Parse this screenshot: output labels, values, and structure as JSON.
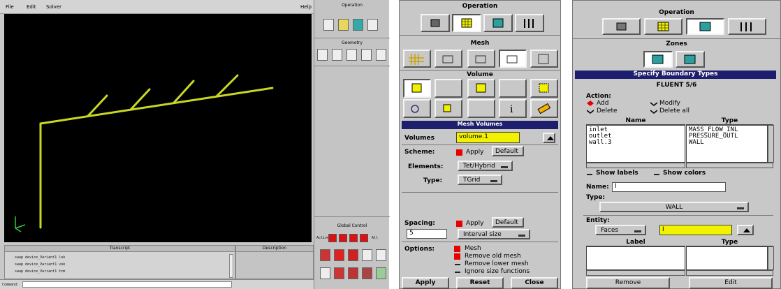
{
  "gambit": {
    "menu": [
      "File",
      "Edit",
      "Solver",
      "Help"
    ],
    "operation_title": "Operation",
    "geometry_title": "Geometry",
    "global_control_title": "Global Control",
    "global_control_label": "Active",
    "global_control_all": "All",
    "transcript_title": "Transcript",
    "description_title": "Description",
    "transcript_lines": [
      "swap device_Variant1 lok",
      "swap device_Variant1 vok",
      "swap device_Variant1 tcm"
    ],
    "command_label": "Command:",
    "colors": {
      "viewport": "#000000",
      "model": "#c9d820",
      "axis": "#38c838"
    }
  },
  "mesh_panel": {
    "operation_title": "Operation",
    "mesh_title": "Mesh",
    "volume_title": "Volume",
    "form_title": "Mesh Volumes",
    "volumes_label": "Volumes",
    "volumes_value": "volume.1",
    "scheme_label": "Scheme:",
    "apply_label": "Apply",
    "default_label": "Default",
    "elements_label": "Elements:",
    "elements_value": "Tet/Hybrid",
    "type_label": "Type:",
    "type_value": "TGrid",
    "spacing_label": "Spacing:",
    "spacing_apply": "Apply",
    "spacing_default": "Default",
    "spacing_value": "5",
    "spacing_mode": "Interval size",
    "options_label": "Options:",
    "options": [
      {
        "label": "Mesh",
        "checked": true
      },
      {
        "label": "Remove old mesh",
        "checked": true
      },
      {
        "label": "Remove lower mesh",
        "checked": false
      },
      {
        "label": "Ignore size functions",
        "checked": false
      }
    ],
    "buttons": {
      "apply": "Apply",
      "reset": "Reset",
      "close": "Close"
    },
    "colors": {
      "title_bar": "#1e1e6e",
      "highlight": "#f2f200",
      "flag": "#e60000"
    }
  },
  "boundary_panel": {
    "operation_title": "Operation",
    "zones_title": "Zones",
    "form_title": "Specify Boundary Types",
    "solver": "FLUENT 5/6",
    "action_label": "Action:",
    "actions": {
      "add": "Add",
      "modify": "Modify",
      "delete": "Delete",
      "delete_all": "Delete all"
    },
    "table_headers": {
      "name": "Name",
      "type": "Type"
    },
    "rows": [
      {
        "name": "inlet",
        "type": "MASS_FLOW_INL"
      },
      {
        "name": "outlet",
        "type": "PRESSURE_OUTL"
      },
      {
        "name": "wall.3",
        "type": "WALL"
      }
    ],
    "show_labels": "Show labels",
    "show_colors": "Show colors",
    "name_label": "Name:",
    "name_value": "I",
    "type_label": "Type:",
    "type_value": "WALL",
    "entity_label": "Entity:",
    "entity_value": "Faces",
    "entity_input": "I",
    "lower_headers": {
      "label": "Label",
      "type": "Type"
    },
    "buttons": {
      "remove": "Remove",
      "edit": "Edit"
    }
  }
}
